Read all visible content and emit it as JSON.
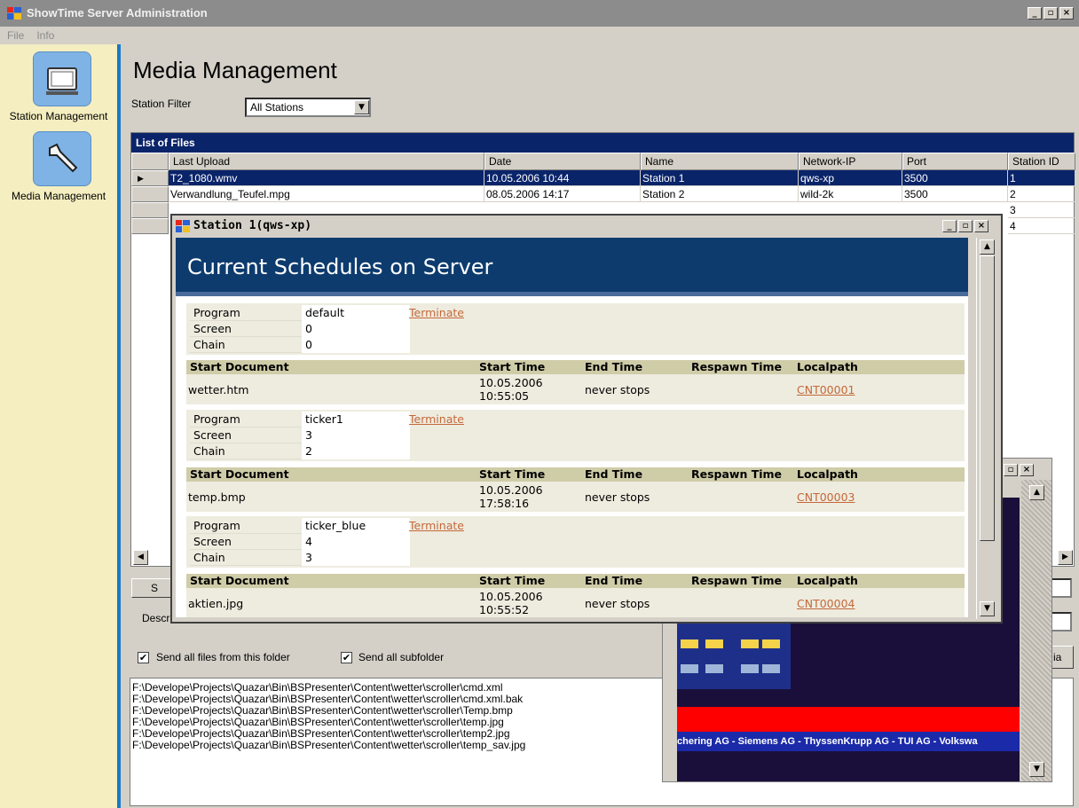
{
  "app": {
    "title": "ShowTime Server Administration",
    "win_min": "_",
    "win_max": "▫",
    "win_close": "×"
  },
  "menu": [
    "File",
    "Info"
  ],
  "sidebar": [
    {
      "label": "Station Management"
    },
    {
      "label": "Media Management"
    }
  ],
  "page": {
    "title": "Media Management",
    "filter_label": "Station Filter",
    "filter_value": "All Stations"
  },
  "grid": {
    "caption": "List of Files",
    "columns": [
      "Last Upload",
      "Date",
      "Name",
      "Network-IP",
      "Port",
      "Station ID"
    ],
    "rows": [
      [
        "T2_1080.wmv",
        "10.05.2006 10:44",
        "Station 1",
        "qws-xp",
        "3500",
        "1"
      ],
      [
        "Verwandlung_Teufel.mpg",
        "08.05.2006 14:17",
        "Station 2",
        "wild-2k",
        "3500",
        "2"
      ],
      [
        "",
        "",
        "",
        "",
        "",
        "3"
      ],
      [
        "",
        "",
        "",
        "",
        "",
        "4"
      ]
    ]
  },
  "lower": {
    "btn_partial": "S",
    "desc_partial": "Descr",
    "send_all_files": "Send all files from this folder",
    "send_subfolders": "Send all subfolder",
    "media_btn_partial": "ia"
  },
  "files": [
    "F:\\Develope\\Projects\\Quazar\\Bin\\BSPresenter\\Content\\wetter\\scroller\\cmd.xml",
    "F:\\Develope\\Projects\\Quazar\\Bin\\BSPresenter\\Content\\wetter\\scroller\\cmd.xml.bak",
    "F:\\Develope\\Projects\\Quazar\\Bin\\BSPresenter\\Content\\wetter\\scroller\\Temp.bmp",
    "F:\\Develope\\Projects\\Quazar\\Bin\\BSPresenter\\Content\\wetter\\scroller\\temp.jpg",
    "F:\\Develope\\Projects\\Quazar\\Bin\\BSPresenter\\Content\\wetter\\scroller\\temp2.jpg",
    "F:\\Develope\\Projects\\Quazar\\Bin\\BSPresenter\\Content\\wetter\\scroller\\temp_sav.jpg"
  ],
  "preview": {
    "ticker": "chering AG - Siemens AG - ThyssenKrupp AG - TUI AG - Volkswa"
  },
  "dialog": {
    "title": "Station 1(qws-xp)",
    "heading": "Current Schedules on Server",
    "labels": {
      "program": "Program",
      "screen": "Screen",
      "chain": "Chain",
      "terminate": "Terminate",
      "start_doc": "Start Document",
      "start_time": "Start Time",
      "end_time": "End Time",
      "respawn": "Respawn Time",
      "localpath": "Localpath"
    },
    "schedules": [
      {
        "program": "default",
        "screen": "0",
        "chain": "0",
        "doc": "wetter.htm",
        "start1": "10.05.2006",
        "start2": "10:55:05",
        "end": "never stops",
        "path": "CNT00001"
      },
      {
        "program": "ticker1",
        "screen": "3",
        "chain": "2",
        "doc": "temp.bmp",
        "start1": "10.05.2006",
        "start2": "17:58:16",
        "end": "never stops",
        "path": "CNT00003"
      },
      {
        "program": "ticker_blue",
        "screen": "4",
        "chain": "3",
        "doc": "aktien.jpg",
        "start1": "10.05.2006",
        "start2": "10:55:52",
        "end": "never stops",
        "path": "CNT00004"
      }
    ]
  }
}
